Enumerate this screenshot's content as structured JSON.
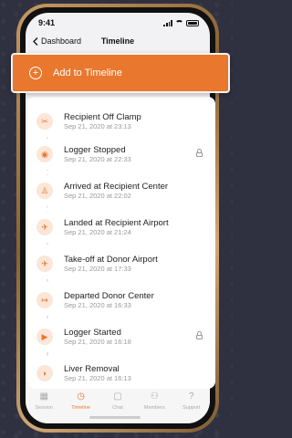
{
  "status_bar": {
    "time": "9:41"
  },
  "nav": {
    "back_label": "Dashboard",
    "title": "Timeline"
  },
  "add_button": {
    "label": "Add to Timeline"
  },
  "accent_color": "#e9772e",
  "timeline": [
    {
      "title": "Recipient Off Clamp",
      "date": "Sep 21, 2020 at 23:13",
      "icon": "clamp-icon",
      "locked": false
    },
    {
      "title": "Logger Stopped",
      "date": "Sep 21, 2020 at 22:33",
      "icon": "stop-icon",
      "locked": true
    },
    {
      "title": "Arrived at Recipient Center",
      "date": "Sep 21, 2020 at 22:02",
      "icon": "person-icon",
      "locked": false
    },
    {
      "title": "Landed at Recipient Airport",
      "date": "Sep 21, 2020 at 21:24",
      "icon": "plane-landing-icon",
      "locked": false
    },
    {
      "title": "Take-off at Donor Airport",
      "date": "Sep 21, 2020 at 17:33",
      "icon": "plane-takeoff-icon",
      "locked": false
    },
    {
      "title": "Departed Donor Center",
      "date": "Sep 21, 2020 at 16:33",
      "icon": "exit-icon",
      "locked": false
    },
    {
      "title": "Logger Started",
      "date": "Sep 21, 2020 at 16:18",
      "icon": "play-icon",
      "locked": true
    },
    {
      "title": "Liver Removal",
      "date": "Sep 21, 2020 at 16:13",
      "icon": "liver-icon",
      "locked": false
    }
  ],
  "tabs": [
    {
      "label": "Session",
      "icon": "grid-icon",
      "active": false
    },
    {
      "label": "Timeline",
      "icon": "clock-icon",
      "active": true
    },
    {
      "label": "Chat",
      "icon": "chat-icon",
      "active": false
    },
    {
      "label": "Members",
      "icon": "members-icon",
      "active": false
    },
    {
      "label": "Support",
      "icon": "help-icon",
      "active": false
    }
  ]
}
